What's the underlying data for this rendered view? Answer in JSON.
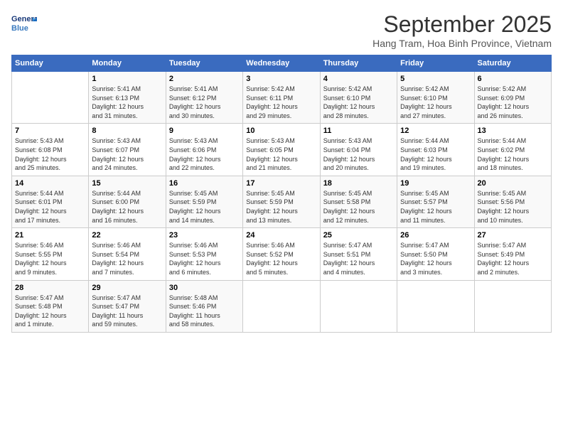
{
  "logo": {
    "line1": "General",
    "line2": "Blue"
  },
  "title": "September 2025",
  "subtitle": "Hang Tram, Hoa Binh Province, Vietnam",
  "weekdays": [
    "Sunday",
    "Monday",
    "Tuesday",
    "Wednesday",
    "Thursday",
    "Friday",
    "Saturday"
  ],
  "weeks": [
    [
      {
        "day": "",
        "info": ""
      },
      {
        "day": "1",
        "info": "Sunrise: 5:41 AM\nSunset: 6:13 PM\nDaylight: 12 hours\nand 31 minutes."
      },
      {
        "day": "2",
        "info": "Sunrise: 5:41 AM\nSunset: 6:12 PM\nDaylight: 12 hours\nand 30 minutes."
      },
      {
        "day": "3",
        "info": "Sunrise: 5:42 AM\nSunset: 6:11 PM\nDaylight: 12 hours\nand 29 minutes."
      },
      {
        "day": "4",
        "info": "Sunrise: 5:42 AM\nSunset: 6:10 PM\nDaylight: 12 hours\nand 28 minutes."
      },
      {
        "day": "5",
        "info": "Sunrise: 5:42 AM\nSunset: 6:10 PM\nDaylight: 12 hours\nand 27 minutes."
      },
      {
        "day": "6",
        "info": "Sunrise: 5:42 AM\nSunset: 6:09 PM\nDaylight: 12 hours\nand 26 minutes."
      }
    ],
    [
      {
        "day": "7",
        "info": "Sunrise: 5:43 AM\nSunset: 6:08 PM\nDaylight: 12 hours\nand 25 minutes."
      },
      {
        "day": "8",
        "info": "Sunrise: 5:43 AM\nSunset: 6:07 PM\nDaylight: 12 hours\nand 24 minutes."
      },
      {
        "day": "9",
        "info": "Sunrise: 5:43 AM\nSunset: 6:06 PM\nDaylight: 12 hours\nand 22 minutes."
      },
      {
        "day": "10",
        "info": "Sunrise: 5:43 AM\nSunset: 6:05 PM\nDaylight: 12 hours\nand 21 minutes."
      },
      {
        "day": "11",
        "info": "Sunrise: 5:43 AM\nSunset: 6:04 PM\nDaylight: 12 hours\nand 20 minutes."
      },
      {
        "day": "12",
        "info": "Sunrise: 5:44 AM\nSunset: 6:03 PM\nDaylight: 12 hours\nand 19 minutes."
      },
      {
        "day": "13",
        "info": "Sunrise: 5:44 AM\nSunset: 6:02 PM\nDaylight: 12 hours\nand 18 minutes."
      }
    ],
    [
      {
        "day": "14",
        "info": "Sunrise: 5:44 AM\nSunset: 6:01 PM\nDaylight: 12 hours\nand 17 minutes."
      },
      {
        "day": "15",
        "info": "Sunrise: 5:44 AM\nSunset: 6:00 PM\nDaylight: 12 hours\nand 16 minutes."
      },
      {
        "day": "16",
        "info": "Sunrise: 5:45 AM\nSunset: 5:59 PM\nDaylight: 12 hours\nand 14 minutes."
      },
      {
        "day": "17",
        "info": "Sunrise: 5:45 AM\nSunset: 5:59 PM\nDaylight: 12 hours\nand 13 minutes."
      },
      {
        "day": "18",
        "info": "Sunrise: 5:45 AM\nSunset: 5:58 PM\nDaylight: 12 hours\nand 12 minutes."
      },
      {
        "day": "19",
        "info": "Sunrise: 5:45 AM\nSunset: 5:57 PM\nDaylight: 12 hours\nand 11 minutes."
      },
      {
        "day": "20",
        "info": "Sunrise: 5:45 AM\nSunset: 5:56 PM\nDaylight: 12 hours\nand 10 minutes."
      }
    ],
    [
      {
        "day": "21",
        "info": "Sunrise: 5:46 AM\nSunset: 5:55 PM\nDaylight: 12 hours\nand 9 minutes."
      },
      {
        "day": "22",
        "info": "Sunrise: 5:46 AM\nSunset: 5:54 PM\nDaylight: 12 hours\nand 7 minutes."
      },
      {
        "day": "23",
        "info": "Sunrise: 5:46 AM\nSunset: 5:53 PM\nDaylight: 12 hours\nand 6 minutes."
      },
      {
        "day": "24",
        "info": "Sunrise: 5:46 AM\nSunset: 5:52 PM\nDaylight: 12 hours\nand 5 minutes."
      },
      {
        "day": "25",
        "info": "Sunrise: 5:47 AM\nSunset: 5:51 PM\nDaylight: 12 hours\nand 4 minutes."
      },
      {
        "day": "26",
        "info": "Sunrise: 5:47 AM\nSunset: 5:50 PM\nDaylight: 12 hours\nand 3 minutes."
      },
      {
        "day": "27",
        "info": "Sunrise: 5:47 AM\nSunset: 5:49 PM\nDaylight: 12 hours\nand 2 minutes."
      }
    ],
    [
      {
        "day": "28",
        "info": "Sunrise: 5:47 AM\nSunset: 5:48 PM\nDaylight: 12 hours\nand 1 minute."
      },
      {
        "day": "29",
        "info": "Sunrise: 5:47 AM\nSunset: 5:47 PM\nDaylight: 11 hours\nand 59 minutes."
      },
      {
        "day": "30",
        "info": "Sunrise: 5:48 AM\nSunset: 5:46 PM\nDaylight: 11 hours\nand 58 minutes."
      },
      {
        "day": "",
        "info": ""
      },
      {
        "day": "",
        "info": ""
      },
      {
        "day": "",
        "info": ""
      },
      {
        "day": "",
        "info": ""
      }
    ]
  ]
}
